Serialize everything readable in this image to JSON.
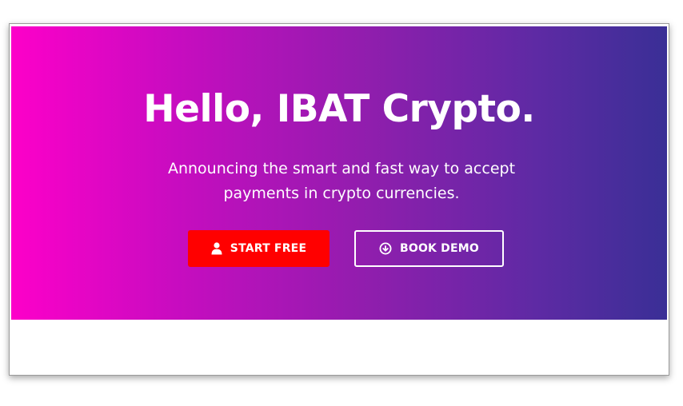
{
  "hero": {
    "title": "Hello, IBAT Crypto.",
    "subtitle": "Announcing the smart and fast way to accept payments in crypto currencies.",
    "primary_button": {
      "label": "START FREE",
      "icon": "user-icon"
    },
    "secondary_button": {
      "label": "BOOK DEMO",
      "icon": "download-circle-icon"
    }
  },
  "colors": {
    "gradient_start": "#fd00c9",
    "gradient_end": "#3a2f96",
    "primary_button": "#ff0000"
  }
}
